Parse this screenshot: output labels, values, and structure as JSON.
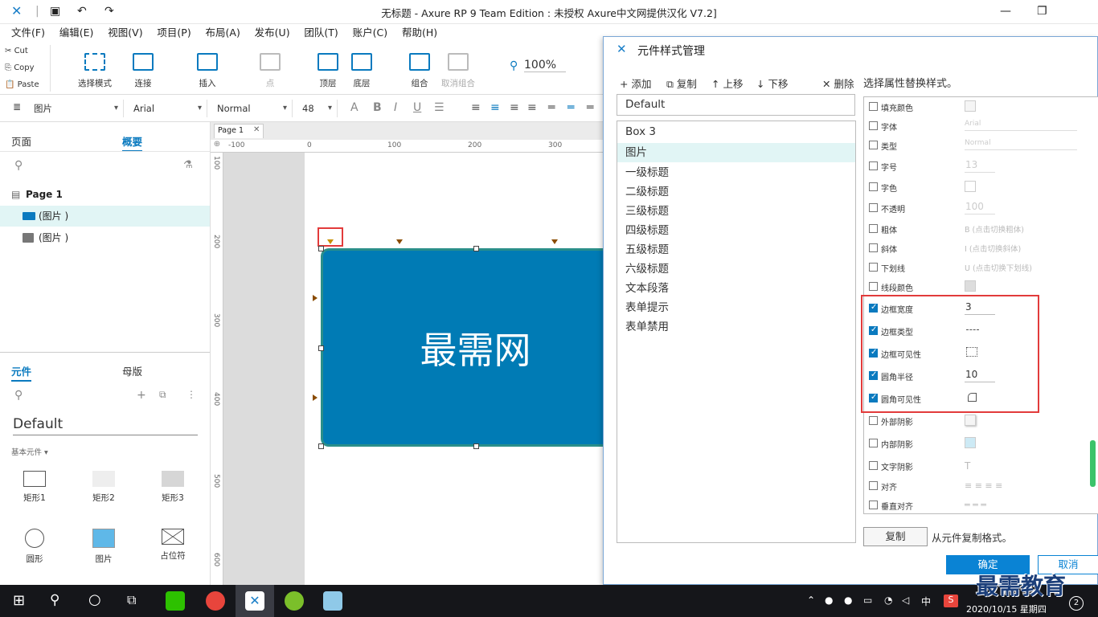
{
  "window": {
    "title": "无标题 - Axure RP 9 Team Edition : 未授权    Axure中文网提供汉化 V7.2]"
  },
  "menu": [
    "文件(F)",
    "编辑(E)",
    "视图(V)",
    "项目(P)",
    "布局(A)",
    "发布(U)",
    "团队(T)",
    "账户(C)",
    "帮助(H)"
  ],
  "clipboard": {
    "cut": "Cut",
    "copy": "Copy",
    "paste": "Paste"
  },
  "toolbar": {
    "select_mode": "选择模式",
    "connect": "连接",
    "insert": "插入",
    "point": "点",
    "front": "顶层",
    "back": "底层",
    "group": "组合",
    "ungroup": "取消组合",
    "zoom": "100%"
  },
  "format": {
    "widget": "图片",
    "font": "Arial",
    "weight": "Normal",
    "size": "48"
  },
  "left_panel": {
    "tab_pages": "页面",
    "tab_outline": "概要",
    "page_name": "Page 1",
    "outline_items": [
      "(图片 )",
      "(图片 )"
    ],
    "tab_widgets": "元件",
    "tab_masters": "母版",
    "library": "Default",
    "section": "基本元件 ▾",
    "widgets": [
      "矩形1",
      "矩形2",
      "矩形3",
      "圆形",
      "图片",
      "占位符"
    ]
  },
  "canvas": {
    "tab": "Page 1",
    "ruler_top": [
      "-100",
      "0",
      "100",
      "200",
      "300"
    ],
    "ruler_left": [
      "100",
      "200",
      "300",
      "400",
      "500",
      "600"
    ],
    "box_text": "最需网"
  },
  "dialog": {
    "title": "元件样式管理",
    "add": "添加",
    "duplicate": "复制",
    "up": "上移",
    "down": "下移",
    "delete": "删除",
    "hint": "选择属性替换样式。",
    "default_style": "Default",
    "styles": [
      "Box 3",
      "图片",
      "一级标题",
      "二级标题",
      "三级标题",
      "四级标题",
      "五级标题",
      "六级标题",
      "文本段落",
      "表单提示",
      "表单禁用"
    ],
    "properties": [
      {
        "label": "填充颜色",
        "checked": false
      },
      {
        "label": "字体",
        "checked": false,
        "value": "Arial"
      },
      {
        "label": "类型",
        "checked": false,
        "value": "Normal"
      },
      {
        "label": "字号",
        "checked": false,
        "value": "13"
      },
      {
        "label": "字色",
        "checked": false
      },
      {
        "label": "不透明",
        "checked": false,
        "value": "100"
      },
      {
        "label": "粗体",
        "checked": false,
        "note": "(点击切换粗体)"
      },
      {
        "label": "斜体",
        "checked": false,
        "note": "(点击切换斜体)"
      },
      {
        "label": "下划线",
        "checked": false,
        "note": "(点击切换下划线)"
      },
      {
        "label": "线段颜色",
        "checked": false
      },
      {
        "label": "边框宽度",
        "checked": true,
        "value": "3"
      },
      {
        "label": "边框类型",
        "checked": true
      },
      {
        "label": "边框可见性",
        "checked": true
      },
      {
        "label": "圆角半径",
        "checked": true,
        "value": "10"
      },
      {
        "label": "圆角可见性",
        "checked": true
      },
      {
        "label": "外部阴影",
        "checked": false
      },
      {
        "label": "内部阴影",
        "checked": false
      },
      {
        "label": "文字阴影",
        "checked": false
      },
      {
        "label": "对齐",
        "checked": false
      },
      {
        "label": "垂直对齐",
        "checked": false
      }
    ],
    "copy_btn": "复制",
    "copy_hint": "从元件复制格式。",
    "ok": "确定",
    "cancel": "取消"
  },
  "taskbar": {
    "time": "9:",
    "date": "2020/10/15 星期四",
    "ime": "中",
    "notif": "2"
  },
  "watermark": "最需教育",
  "colors": {
    "accent": "#0a7abf",
    "box": "#007bb5",
    "highlight": "#e23b3b"
  }
}
